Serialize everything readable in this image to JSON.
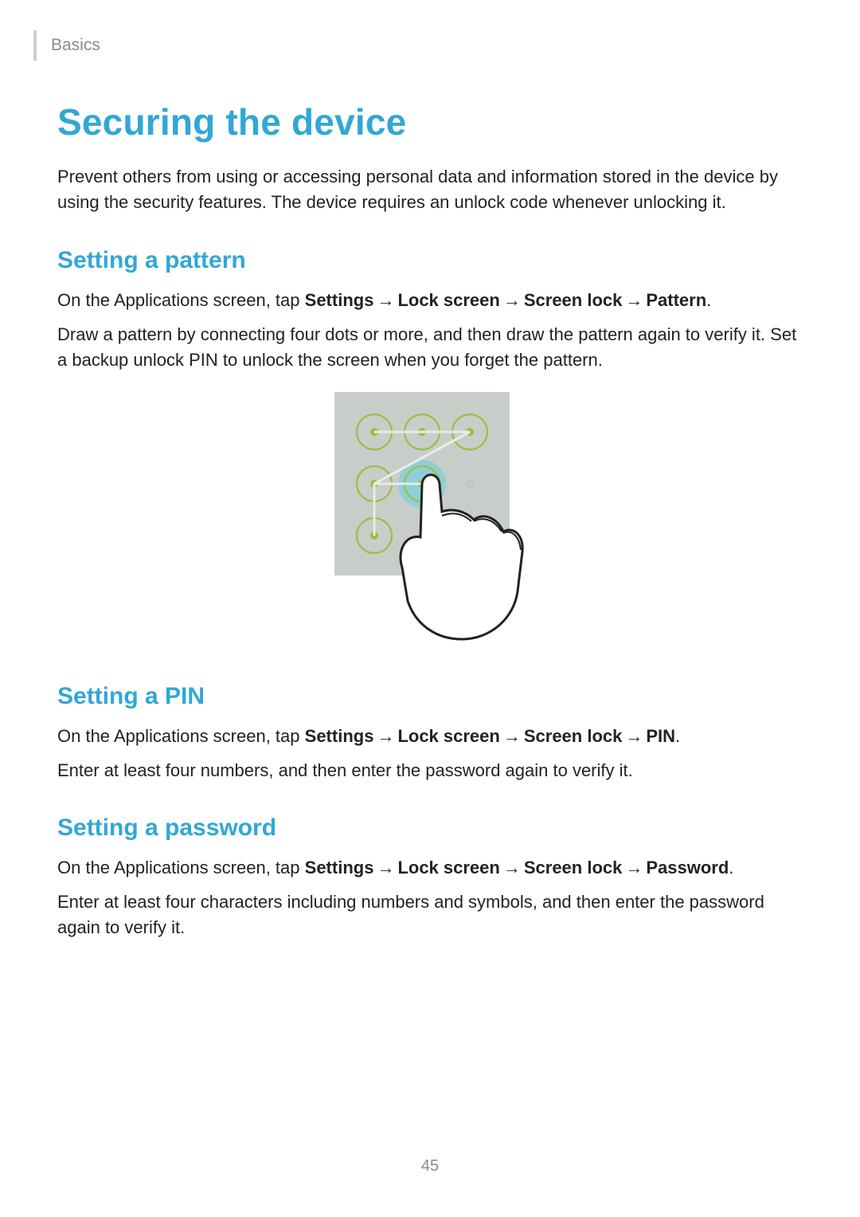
{
  "header": {
    "section": "Basics"
  },
  "title": "Securing the device",
  "intro": "Prevent others from using or accessing personal data and information stored in the device by using the security features. The device requires an unlock code whenever unlocking it.",
  "sections": {
    "pattern": {
      "heading": "Setting a pattern",
      "nav_lead": "On the Applications screen, tap ",
      "nav_steps": [
        "Settings",
        "Lock screen",
        "Screen lock",
        "Pattern"
      ],
      "body": "Draw a pattern by connecting four dots or more, and then draw the pattern again to verify it. Set a backup unlock PIN to unlock the screen when you forget the pattern."
    },
    "pin": {
      "heading": "Setting a PIN",
      "nav_lead": "On the Applications screen, tap ",
      "nav_steps": [
        "Settings",
        "Lock screen",
        "Screen lock",
        "PIN"
      ],
      "body": "Enter at least four numbers, and then enter the password again to verify it."
    },
    "password": {
      "heading": "Setting a password",
      "nav_lead": "On the Applications screen, tap ",
      "nav_steps": [
        "Settings",
        "Lock screen",
        "Screen lock",
        "Password"
      ],
      "body": "Enter at least four characters including numbers and symbols, and then enter the password again to verify it."
    }
  },
  "arrow_glyph": "→",
  "page_number": "45"
}
